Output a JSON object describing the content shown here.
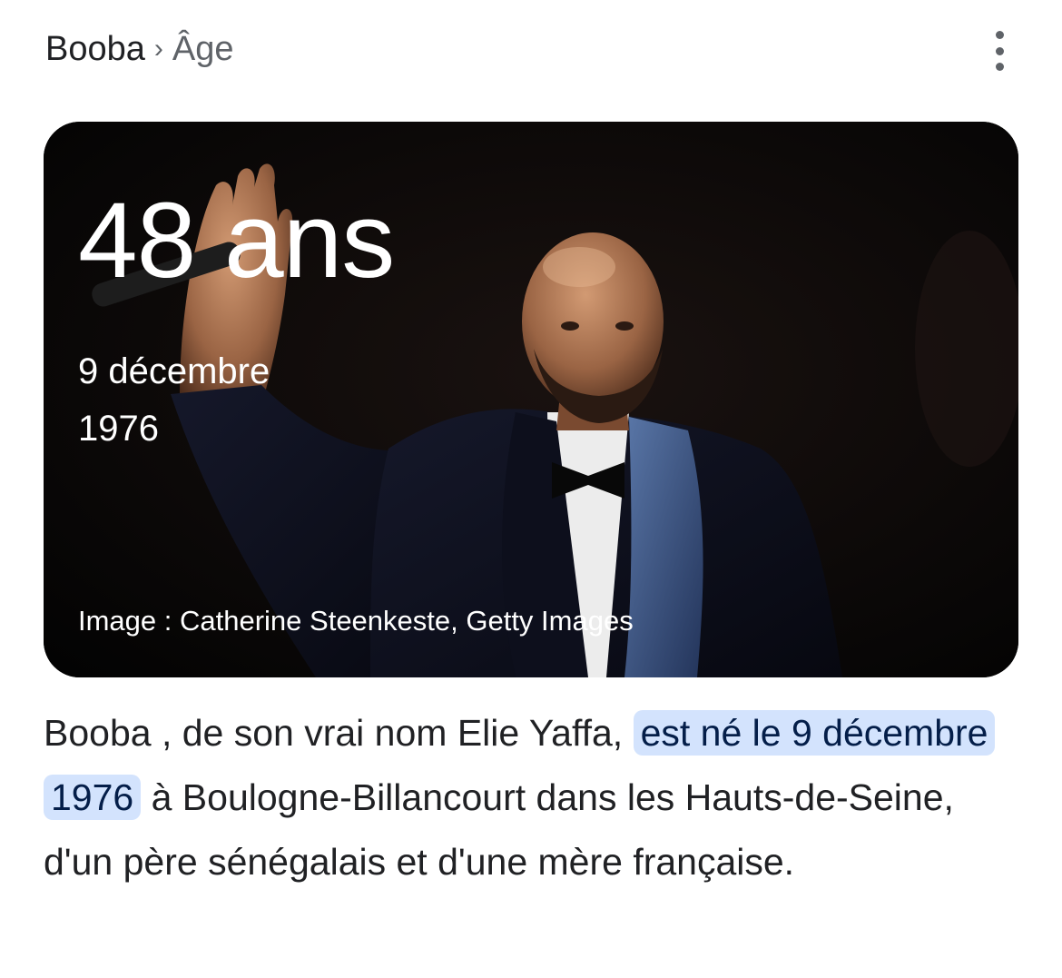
{
  "breadcrumb": {
    "root": "Booba",
    "separator": "›",
    "leaf": "Âge"
  },
  "menu": {
    "icon": "more-vert-icon"
  },
  "card": {
    "age": "48 ans",
    "birth_day_month": "9 décembre",
    "birth_year": "1976",
    "credit": "Image : Catherine Steenkeste, Getty Images"
  },
  "summary": {
    "before": "Booba , de son vrai nom Elie Yaffa, ",
    "highlight": "est né le 9 décembre 1976",
    "after": " à Boulogne-Billancourt dans les Hauts-de-Seine, d'un père sénégalais et d'une mère française."
  },
  "colors": {
    "highlight_bg": "#d3e3fd",
    "highlight_text": "#041e49",
    "text": "#202124",
    "muted": "#5f6368"
  }
}
